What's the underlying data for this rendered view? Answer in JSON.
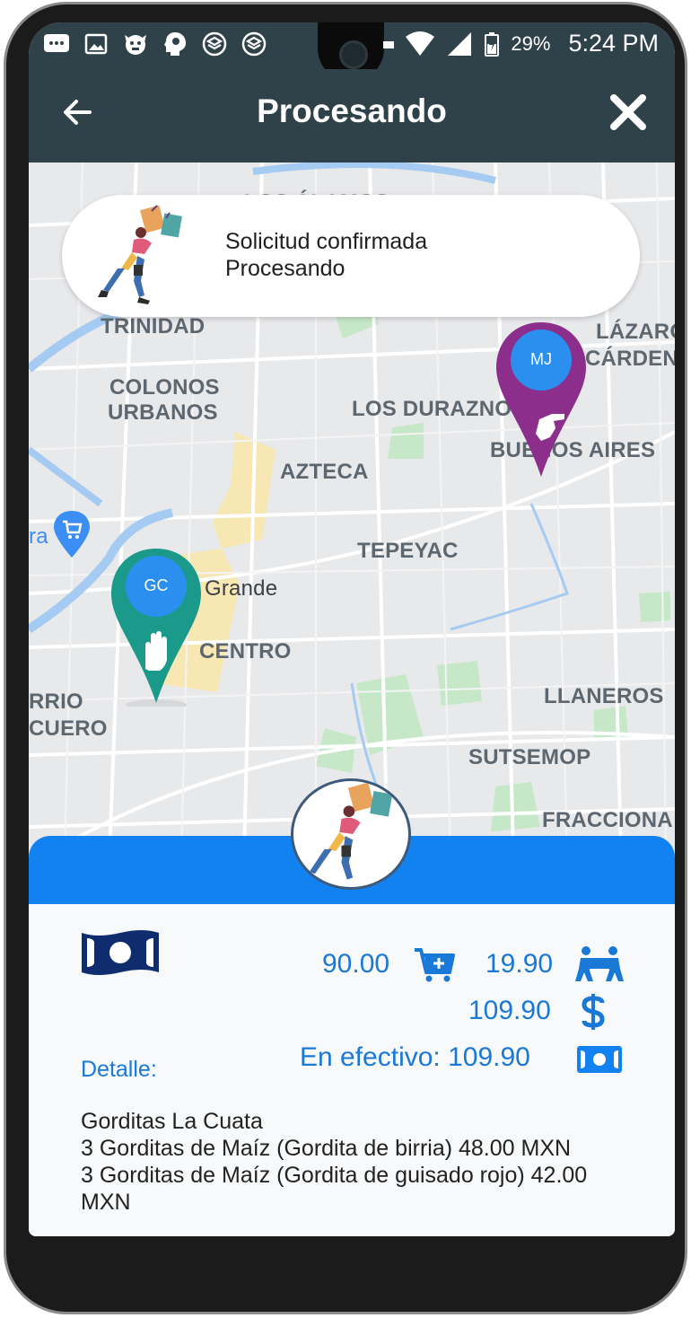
{
  "status_bar": {
    "battery": "29%",
    "time": "5:24 PM"
  },
  "appbar": {
    "title": "Procesando"
  },
  "notice": {
    "line1": "Solicitud confirmada",
    "line2": "Procesando"
  },
  "map": {
    "labels": [
      "LOS ÁLAMOS",
      "TRINIDAD",
      "COLONOS",
      "URBANOS",
      "LOS DURAZNOS",
      "LÁZARO",
      "CÁRDENAS",
      "BUENOS AIRES",
      "AZTECA",
      "TEPEYAC",
      "Grande",
      "CENTRO",
      "RRIO",
      "CUERO",
      "LLANEROS",
      "SUTSEMOP",
      "FRACCIONA",
      "ra"
    ],
    "pins": {
      "client": {
        "initials": "GC",
        "color": "#1b9a8c"
      },
      "delivery": {
        "initials": "MJ",
        "color": "#8c2f8c"
      }
    }
  },
  "summary": {
    "products_amount": "90.00",
    "delivery_amount": "19.90",
    "total_amount": "109.90",
    "cash_text": "En efectivo: 109.90"
  },
  "detail": {
    "title": "Detalle:",
    "store": "Gorditas La Cuata",
    "item1": "3 Gorditas de Maíz (Gordita de birria) 48.00 MXN",
    "item2a": "3 Gorditas de Maíz (Gordita de guisado rojo) 42.00",
    "item2b": "MXN"
  },
  "colors": {
    "appbar": "#2f4249",
    "accent_blue": "#1282f0",
    "text_blue": "#1a78d6",
    "money_dark": "#0e2c6e"
  }
}
